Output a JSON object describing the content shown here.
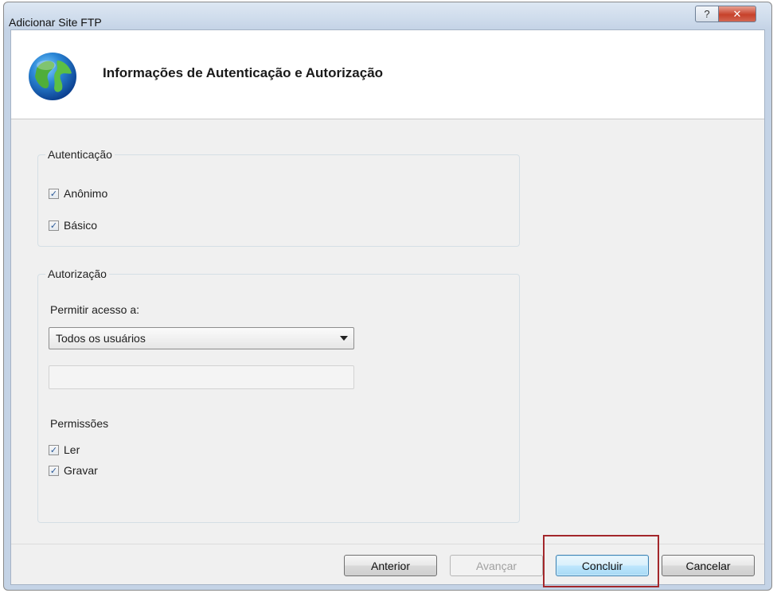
{
  "window": {
    "title": "Adicionar Site FTP",
    "help_glyph": "?",
    "close_glyph": "✕"
  },
  "header": {
    "title": "Informações de Autenticação e Autorização",
    "icon": "globe-icon"
  },
  "authentication": {
    "legend": "Autenticação",
    "options": [
      {
        "label": "Anônimo",
        "checked": true
      },
      {
        "label": "Básico",
        "checked": true
      }
    ]
  },
  "authorization": {
    "legend": "Autorização",
    "allow_access_label": "Permitir acesso a:",
    "allow_access_value": "Todos os usuários",
    "user_field_value": "",
    "permissions_label": "Permissões",
    "permissions": [
      {
        "label": "Ler",
        "checked": true
      },
      {
        "label": "Gravar",
        "checked": true
      }
    ]
  },
  "buttons": {
    "previous": "Anterior",
    "next": "Avançar",
    "finish": "Concluir",
    "cancel": "Cancelar"
  },
  "check_glyph": "✓",
  "colors": {
    "highlight_border": "#a3272b",
    "default_button_border": "#3c7fb1"
  }
}
